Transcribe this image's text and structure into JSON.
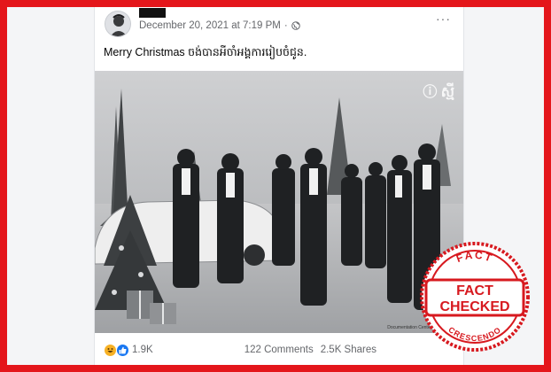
{
  "post": {
    "timestamp": "December 20, 2021 at 7:19 PM",
    "separator": "·",
    "privacy_icon": "globe-icon",
    "more_icon": "ellipsis-icon",
    "more_label": "···",
    "caption": "Merry Christmas ចង់បានអីចាំអង្គការរៀបចំជូន."
  },
  "photo": {
    "watermark": "ⓘ ស្មី",
    "credit": "Documentation Center of Cambodia"
  },
  "footer": {
    "reaction_icons": [
      "haha-icon",
      "like-icon"
    ],
    "reaction_count": "1.9K",
    "comments": "122 Comments",
    "shares": "2.5K Shares"
  },
  "stamp": {
    "top_text": "FACT",
    "main_line1": "FACT",
    "main_line2": "CHECKED",
    "bottom_text": "CRESCENDO",
    "color": "#d7191f"
  },
  "colors": {
    "border": "#e4161b",
    "meta_text": "#65676b",
    "like_blue": "#1877f2",
    "haha_yellow": "#f7b125"
  }
}
